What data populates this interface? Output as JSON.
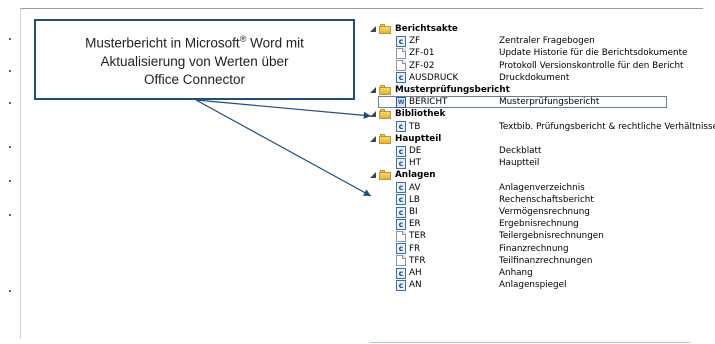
{
  "callout": {
    "line1_prefix": "Musterbericht in Microsoft",
    "line1_mark": "®",
    "line1_suffix": " Word mit",
    "line2": "Aktualisierung von Werten über",
    "line3": "Office Connector"
  },
  "tree": {
    "groups": [
      {
        "label": "Berichtsakte",
        "items": [
          {
            "icon": "c",
            "code": "ZF",
            "desc": "Zentraler Fragebogen"
          },
          {
            "icon": "blank",
            "code": "ZF-01",
            "desc": "Update Historie für die Berichtsdokumente"
          },
          {
            "icon": "blank",
            "code": "ZF-02",
            "desc": "Protokoll Versionskontrolle für den Bericht"
          },
          {
            "icon": "c",
            "code": "AUSDRUCK",
            "desc": "Druckdokument"
          }
        ]
      },
      {
        "label": "Musterprüfungsbericht",
        "items": [
          {
            "icon": "word",
            "code": "BERICHT",
            "desc": "Musterprüfungsbericht",
            "selected": true
          }
        ]
      },
      {
        "label": "Bibliothek",
        "items": [
          {
            "icon": "c",
            "code": "TB",
            "desc": "Textbib. Prüfungsbericht & rechtliche Verhältnisse"
          }
        ]
      },
      {
        "label": "Hauptteil",
        "items": [
          {
            "icon": "c",
            "code": "DE",
            "desc": "Deckblatt"
          },
          {
            "icon": "c",
            "code": "HT",
            "desc": "Hauptteil"
          }
        ]
      },
      {
        "label": "Anlagen",
        "items": [
          {
            "icon": "c",
            "code": "AV",
            "desc": "Anlagenverzeichnis"
          },
          {
            "icon": "c",
            "code": "LB",
            "desc": "Rechenschaftsbericht"
          },
          {
            "icon": "c",
            "code": "BI",
            "desc": "Vermögensrechnung"
          },
          {
            "icon": "c",
            "code": "ER",
            "desc": "Ergebnisrechnung"
          },
          {
            "icon": "blank",
            "code": "TER",
            "desc": "Teilergebnisrechnungen"
          },
          {
            "icon": "c",
            "code": "FR",
            "desc": "Finanzrechnung"
          },
          {
            "icon": "blank",
            "code": "TFR",
            "desc": "Teilfinanzrechnungen"
          },
          {
            "icon": "c",
            "code": "AH",
            "desc": "Anhang"
          },
          {
            "icon": "c",
            "code": "AN",
            "desc": "Anlagenspiegel"
          }
        ]
      }
    ]
  },
  "colors": {
    "callout_border": "#1f4e79",
    "arrow": "#1f4e79",
    "folder": "#e9c354"
  }
}
